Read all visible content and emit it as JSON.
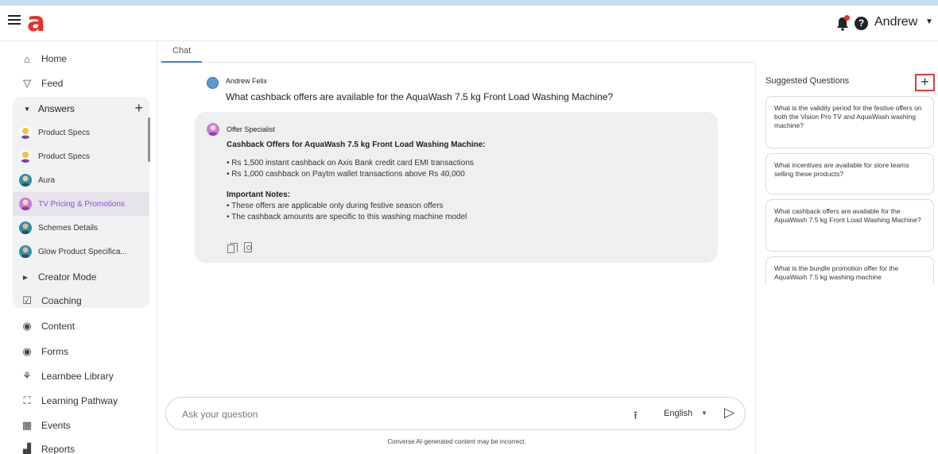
{
  "header": {
    "logo": "a",
    "user_name": "Andrew"
  },
  "sidebar": {
    "top_items": [
      {
        "label": "Home",
        "icon": "home-icon"
      },
      {
        "label": "Feed",
        "icon": "feed-icon"
      }
    ],
    "answers": {
      "label": "Answers",
      "items": [
        {
          "label": "Product Specs"
        },
        {
          "label": "Product Specs"
        },
        {
          "label": "Aura"
        },
        {
          "label": "TV Pricing & Promotions",
          "active": true
        },
        {
          "label": "Schemes Details"
        },
        {
          "label": "Glow Product Specifica..."
        }
      ]
    },
    "bottom_items": [
      {
        "label": "Creator Mode",
        "icon": "caret-right-icon"
      },
      {
        "label": "Coaching",
        "icon": "checkbox-icon"
      },
      {
        "label": "Content",
        "icon": "content-icon"
      },
      {
        "label": "Forms",
        "icon": "forms-icon"
      },
      {
        "label": "Learnbee Library",
        "icon": "library-icon"
      },
      {
        "label": "Learning Pathway",
        "icon": "pathway-icon"
      },
      {
        "label": "Events",
        "icon": "calendar-icon"
      },
      {
        "label": "Reports",
        "icon": "reports-icon"
      }
    ]
  },
  "chat": {
    "tab_label": "Chat",
    "question": {
      "author": "Andrew Felix",
      "text": "What cashback offers are available for the AquaWash 7.5 kg Front Load Washing Machine?"
    },
    "answer": {
      "author": "Offer Specialist",
      "title": "Cashback Offers for AquaWash 7.5 kg Front Load Washing Machine:",
      "bullets": [
        "• Rs 1,500 instant cashback on Axis Bank credit card EMI transactions",
        "• Rs 1,000 cashback on Paytm wallet transactions above Rs 40,000"
      ],
      "notes_title": "Important Notes:",
      "notes": [
        "• These offers are applicable only during festive season offers",
        "• The cashback amounts are specific to this washing machine model"
      ]
    },
    "input": {
      "placeholder": "Ask your question",
      "language": "English"
    },
    "disclaimer": "Converse AI-generated content may be incorrect."
  },
  "suggested": {
    "title": "Suggested Questions",
    "questions": [
      "What is the validity period for the festive offers on both the Vision Pro TV and AquaWash washing machine?",
      "What incentives are available for store teams selling these products?",
      "What cashback offers are available for the AquaWash 7.5 kg Front Load Washing Machine?",
      "What is the bundle promotion offer for the AquaWash 7.5 kg washing machine"
    ]
  }
}
